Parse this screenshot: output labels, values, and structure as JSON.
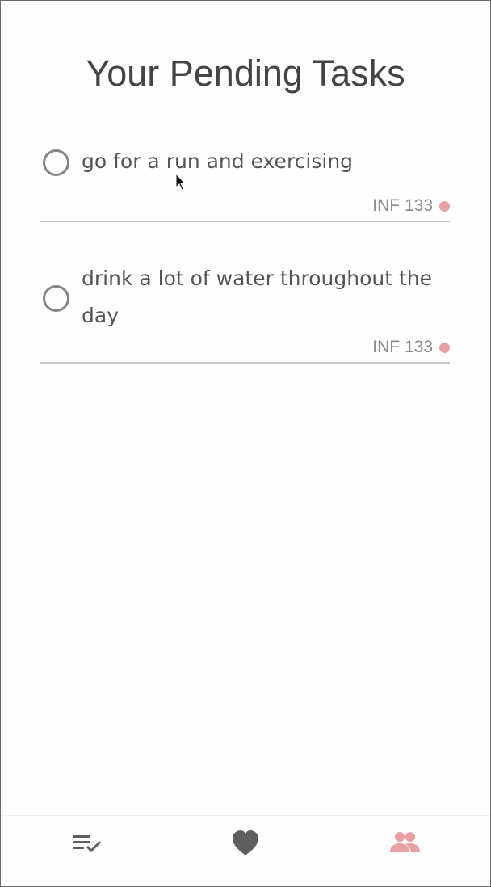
{
  "page": {
    "title": "Your Pending Tasks"
  },
  "tasks": [
    {
      "text": "go for a run and exercising",
      "course": "INF 133",
      "priority_color": "#e8a0a3",
      "completed": false
    },
    {
      "text": "drink a lot of water throughout the day",
      "course": "INF 133",
      "priority_color": "#e8a0a3",
      "completed": false
    }
  ],
  "bottom_nav": {
    "items": [
      {
        "icon": "playlist-check-icon",
        "active": false
      },
      {
        "icon": "heart-icon",
        "active": false
      },
      {
        "icon": "people-icon",
        "active": true
      }
    ],
    "active_color": "#e8a0a3",
    "inactive_color": "#5f5f5f"
  }
}
